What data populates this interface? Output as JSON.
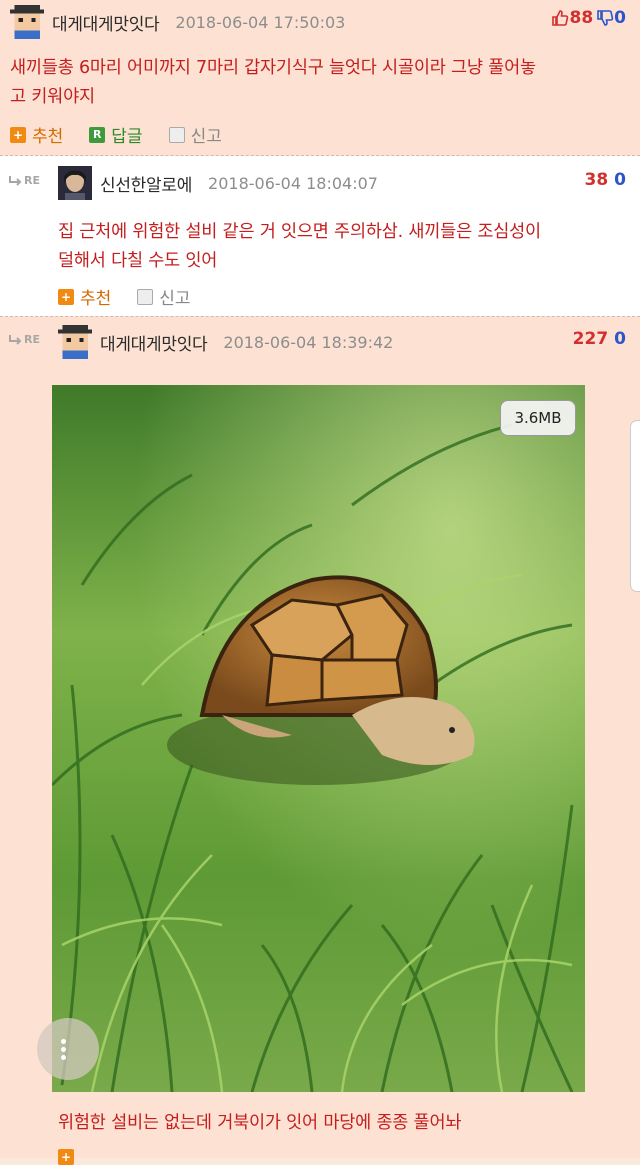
{
  "colors": {
    "accent_red": "#c41e1e",
    "upvote": "#d22f2f",
    "downvote": "#2d55c8",
    "recommend": "#f08a12",
    "reply": "#3d9b3d"
  },
  "posts": [
    {
      "author": "대게대게맛잇다",
      "date": "2018-06-04 17:50:03",
      "up": "88",
      "down": "0",
      "body_lines": [
        "새끼들총 6마리 어미까지 7마리 갑자기식구 늘엇다 시골이라 그냥 풀어놓",
        "고 키워야지"
      ],
      "actions": {
        "recommend": "추천",
        "reply": "답글",
        "report": "신고"
      }
    },
    {
      "re_label": "RE",
      "author": "신선한알로에",
      "date": "2018-06-04 18:04:07",
      "up": "38",
      "down": "0",
      "body_lines": [
        "집 근처에 위험한 설비 같은 거 잇으면 주의하삼. 새끼들은 조심성이",
        "덜해서 다칠 수도 잇어"
      ],
      "actions": {
        "recommend": "추천",
        "report": "신고"
      }
    },
    {
      "re_label": "RE",
      "author": "대게대게맛잇다",
      "date": "2018-06-04 18:39:42",
      "up": "227",
      "down": "0",
      "image_size": "3.6MB",
      "body_lines": [
        "위험한 설비는 없는데 거북이가 잇어 마당에 종종 풀어놔"
      ]
    }
  ]
}
